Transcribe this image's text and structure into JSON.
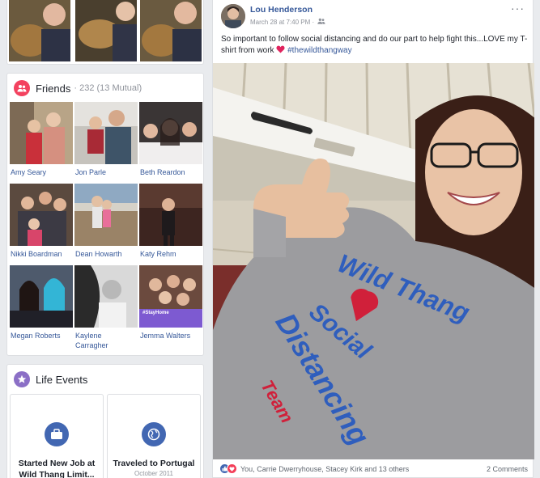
{
  "friends": {
    "title": "Friends",
    "count": "· 232 (13 Mutual)",
    "people": [
      {
        "name": "Amy Seary"
      },
      {
        "name": "Jon Parle"
      },
      {
        "name": "Beth Reardon"
      },
      {
        "name": "Nikki Boardman"
      },
      {
        "name": "Dean Howarth"
      },
      {
        "name": "Katy Rehm"
      },
      {
        "name": "Megan Roberts"
      },
      {
        "name": "Kaylene\nCarragher"
      },
      {
        "name": "Jemma Walters"
      }
    ],
    "tile_caption": "#StayHome"
  },
  "life_events": {
    "title": "Life Events",
    "items": [
      {
        "label": "Started New Job at\nWild Thang Limit...",
        "icon": "briefcase-icon"
      },
      {
        "label": "Traveled to Portugal",
        "date": "October 2011",
        "icon": "globe-icon"
      }
    ]
  },
  "post": {
    "author": "Lou Henderson",
    "date": "March 28 at 7:40 PM ·",
    "audience_icon": "friends-audience-icon",
    "text": "So important to follow social distancing and do our part to help fight this...LOVE my T-shirt from work",
    "hashtag": "#thewildthangway",
    "more": "···",
    "shirt_text": {
      "line1": "Wild Thang",
      "line2": "Social",
      "line3": "Distancing",
      "line4": "Team"
    }
  },
  "reactions": {
    "names": "You, Carrie Dwerryhouse, Stacey Kirk and 13 others",
    "comments": "2 Comments"
  },
  "colors": {
    "link": "#365899",
    "brand": "#4267b2",
    "friends_icon": "#f3425f",
    "life_events_icon": "#8b6fc6",
    "love": "#f33e58"
  }
}
